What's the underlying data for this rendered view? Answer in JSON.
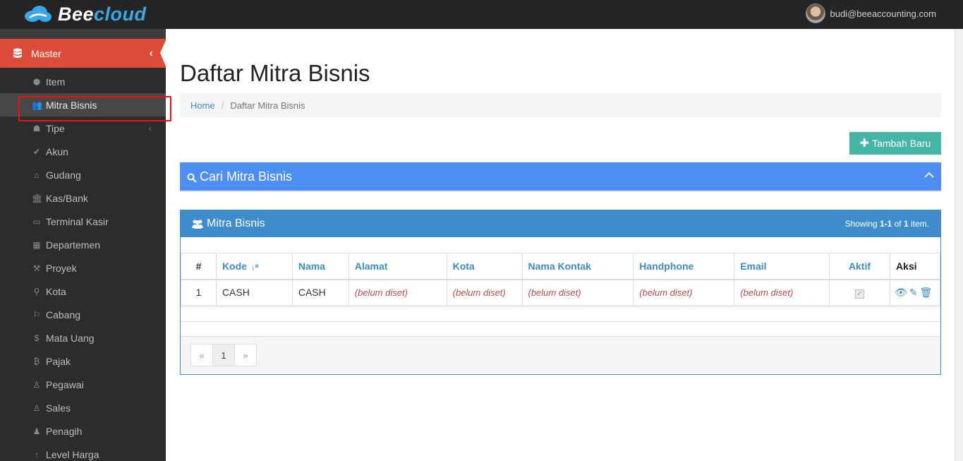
{
  "brand": {
    "part1": "Bee",
    "part2": "cloud"
  },
  "user": {
    "email": "budi@beeaccounting.com"
  },
  "colors": {
    "accent": "#dd4b39",
    "primary": "#3c8dbc",
    "search": "#4d8ef5",
    "add": "#45b6a6"
  },
  "sidebar": {
    "section": "Master",
    "items": [
      {
        "label": "Item",
        "icon": "cube-icon"
      },
      {
        "label": "Mitra Bisnis",
        "icon": "users-icon"
      },
      {
        "label": "Tipe",
        "icon": "sitemap-icon"
      },
      {
        "label": "Akun",
        "icon": "check-icon"
      },
      {
        "label": "Gudang",
        "icon": "home-icon"
      },
      {
        "label": "Kas/Bank",
        "icon": "bank-icon"
      },
      {
        "label": "Terminal Kasir",
        "icon": "monitor-icon"
      },
      {
        "label": "Departemen",
        "icon": "building-icon"
      },
      {
        "label": "Proyek",
        "icon": "hammer-icon"
      },
      {
        "label": "Kota",
        "icon": "map-marker-icon"
      },
      {
        "label": "Cabang",
        "icon": "flag-icon"
      },
      {
        "label": "Mata Uang",
        "icon": "dollar-icon"
      },
      {
        "label": "Pajak",
        "icon": "bitcoin-icon"
      },
      {
        "label": "Pegawai",
        "icon": "person-icon"
      },
      {
        "label": "Sales",
        "icon": "person-icon"
      },
      {
        "label": "Penagih",
        "icon": "user-icon"
      },
      {
        "label": "Level Harga",
        "icon": "arrow-up-icon"
      }
    ]
  },
  "page": {
    "title": "Daftar Mitra Bisnis",
    "breadcrumb": {
      "home": "Home",
      "current": "Daftar Mitra Bisnis"
    },
    "add_button": "Tambah Baru",
    "search_title": "Cari Mitra Bisnis"
  },
  "grid": {
    "title": "Mitra Bisnis",
    "summary_prefix": "Showing ",
    "summary_range": "1-1",
    "summary_of": " of ",
    "summary_total": "1",
    "summary_suffix": " item.",
    "columns": [
      "#",
      "Kode",
      "Nama",
      "Alamat",
      "Kota",
      "Nama Kontak",
      "Handphone",
      "Email",
      "Aktif",
      "Aksi"
    ],
    "rows": [
      {
        "num": "1",
        "kode": "CASH",
        "nama": "CASH",
        "alamat": "(belum diset)",
        "kota": "(belum diset)",
        "kontak": "(belum diset)",
        "handphone": "(belum diset)",
        "email": "(belum diset)",
        "aktif": true
      }
    ],
    "pager": {
      "prev": "«",
      "page": "1",
      "next": "»"
    }
  }
}
